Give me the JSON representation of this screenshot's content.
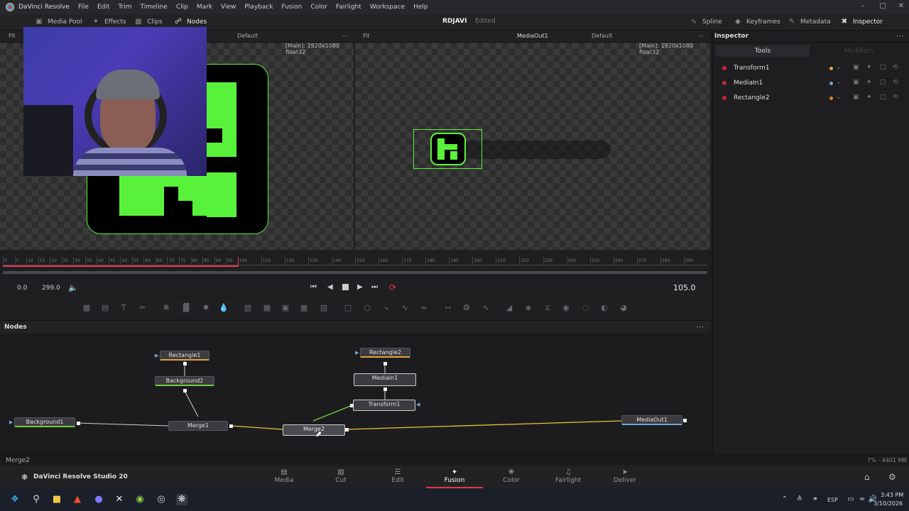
{
  "app": {
    "title": "DaVinci Resolve",
    "menu": [
      "File",
      "Edit",
      "Trim",
      "Timeline",
      "Clip",
      "Mark",
      "View",
      "Playback",
      "Fusion",
      "Color",
      "Fairlight",
      "Workspace",
      "Help"
    ]
  },
  "toolbar": {
    "media_pool": "Media Pool",
    "effects": "Effects",
    "clips": "Clips",
    "nodes": "Nodes",
    "project_name": "RDJAVI",
    "project_status": "Edited",
    "spline": "Spline",
    "keyframes": "Keyframes",
    "metadata": "Metadata",
    "inspector": "Inspector"
  },
  "viewer_left": {
    "fit": "Fit",
    "lut": "Default",
    "info": "[Main]: 1920x1080 float32"
  },
  "viewer_right": {
    "fit": "Fit",
    "node": "MediaOut1",
    "lut": "Default",
    "info": "[Main]: 1920x1080 float32"
  },
  "timeline": {
    "ticks": [
      "0",
      "5",
      "10",
      "15",
      "20",
      "25",
      "30",
      "35",
      "40",
      "45",
      "50",
      "55",
      "60",
      "65",
      "70",
      "75",
      "80",
      "85",
      "90",
      "95",
      "100",
      "110",
      "120",
      "130",
      "140",
      "150",
      "160",
      "170",
      "180",
      "190",
      "200",
      "210",
      "220",
      "230",
      "240",
      "250",
      "260",
      "270",
      "280",
      "290"
    ],
    "start": "0.0",
    "end": "299.0",
    "current": "105.0",
    "playhead": 100
  },
  "nodes_panel": {
    "title": "Nodes",
    "nodes": {
      "rectangle1": "Rectangle1",
      "background2": "Background2",
      "background1": "Background1",
      "merge1": "Merge1",
      "merge2": "Merge2",
      "rectangle2": "Rectangle2",
      "mediain1": "MediaIn1",
      "transform1": "Transform1",
      "mediaout1": "MediaOut1"
    }
  },
  "inspector": {
    "title": "Inspector",
    "tab_tools": "Tools",
    "tab_modifiers": "Modifiers",
    "tools": [
      {
        "name": "Transform1",
        "color": "#e2a23c"
      },
      {
        "name": "MediaIn1",
        "color": "#6aa6d6"
      },
      {
        "name": "Rectangle2",
        "color": "#d48a1e"
      }
    ]
  },
  "status": {
    "left": "Merge2",
    "right": "7% - 4401 MB"
  },
  "pages": {
    "brand": "DaVinci Resolve Studio 20",
    "items": [
      "Media",
      "Cut",
      "Edit",
      "Fusion",
      "Color",
      "Fairlight",
      "Deliver"
    ],
    "active": "Fusion"
  },
  "taskbar": {
    "lang": "ESP",
    "time": "3:43 PM",
    "date": "3/10/2026"
  },
  "colors": {
    "accent": "#e8364f",
    "green": "#59f23a",
    "merge_line": "#e6c431"
  }
}
